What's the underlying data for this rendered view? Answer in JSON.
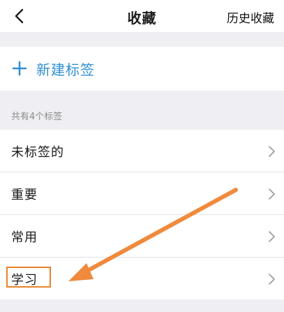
{
  "navbar": {
    "back_icon": "chevron-left-icon",
    "title": "收藏",
    "history_label": "历史收藏"
  },
  "new_tag": {
    "icon": "plus-icon",
    "label": "新建标签",
    "accent_color": "#2f8fd1"
  },
  "section_header": "共有4个标签",
  "tags": [
    {
      "label": "未标签的",
      "icon": "chevron-right-icon"
    },
    {
      "label": "重要",
      "icon": "chevron-right-icon"
    },
    {
      "label": "常用",
      "icon": "chevron-right-icon"
    },
    {
      "label": "学习",
      "icon": "chevron-right-icon",
      "highlighted": true
    }
  ],
  "annotation": {
    "arrow_color": "#f08a3c",
    "highlight_color": "#e8832a"
  }
}
